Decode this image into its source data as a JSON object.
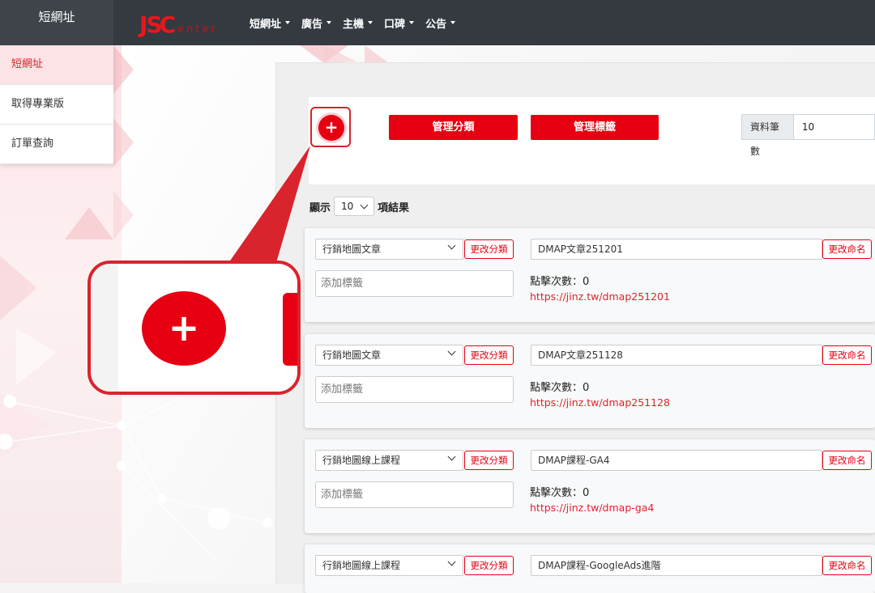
{
  "topbar": {
    "site_title": "短網址",
    "logo_main": "JS",
    "logo_c": "C",
    "logo_sub": "enter",
    "nav": [
      {
        "label": "短網址"
      },
      {
        "label": "廣告"
      },
      {
        "label": "主機"
      },
      {
        "label": "口碑"
      },
      {
        "label": "公告"
      }
    ]
  },
  "sidebar": {
    "items": [
      {
        "label": "短網址",
        "active": true
      },
      {
        "label": "取得專業版",
        "active": false
      },
      {
        "label": "訂單查詢",
        "active": false
      }
    ]
  },
  "toolbar": {
    "add_icon": "plus-icon",
    "add_symbol": "+",
    "manage_categories_label": "管理分類",
    "manage_tags_label": "管理標籤",
    "record_count_label": "資料筆數",
    "record_count_value": "10"
  },
  "list_controls": {
    "show_prefix": "顯示",
    "show_value": "10",
    "show_suffix": "項結果"
  },
  "cards": [
    {
      "category": "行銷地圖文章",
      "change_category_label": "更改分類",
      "tag_placeholder": "添加標籤",
      "name": "DMAP文章251201",
      "rename_label": "更改命名",
      "clicks_label": "點擊次數：0",
      "short_url": "https://jinz.tw/dmap251201"
    },
    {
      "category": "行銷地圖文章",
      "change_category_label": "更改分類",
      "tag_placeholder": "添加標籤",
      "name": "DMAP文章251128",
      "rename_label": "更改命名",
      "clicks_label": "點擊次數：0",
      "short_url": "https://jinz.tw/dmap251128"
    },
    {
      "category": "行銷地圖線上課程",
      "change_category_label": "更改分類",
      "tag_placeholder": "添加標籤",
      "name": "DMAP課程-GA4",
      "rename_label": "更改命名",
      "clicks_label": "點擊次數：0",
      "short_url": "https://jinz.tw/dmap-ga4"
    },
    {
      "category": "行銷地圖線上課程",
      "change_category_label": "更改分類",
      "name": "DMAP課程-GoogleAds進階",
      "rename_label": "更改命名"
    }
  ],
  "callout": {
    "zoom_symbol": "+"
  },
  "colors": {
    "accent": "#e60012",
    "topbar": "#343a40",
    "sidebar_active_bg": "#fbe3e6",
    "link": "#e0232b"
  }
}
